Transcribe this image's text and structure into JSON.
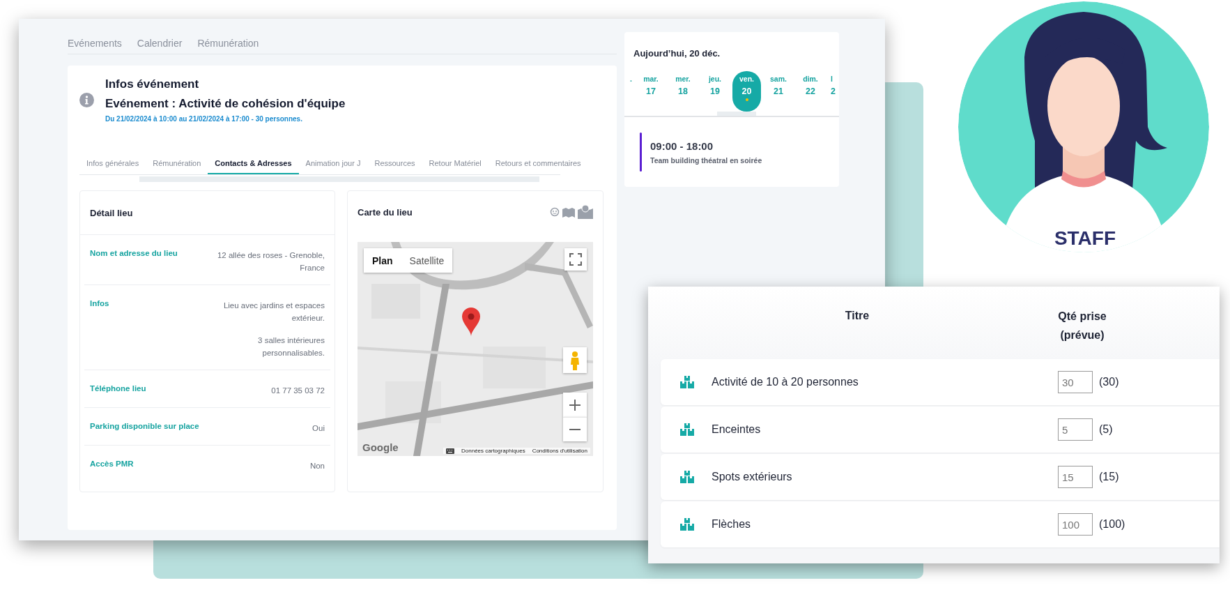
{
  "top_nav": [
    "Evénements",
    "Calendrier",
    "Rémunération"
  ],
  "event": {
    "heading": "Infos événement",
    "title": "Evénement : Activité de cohésion d'équipe",
    "dates": "Du 21/02/2024 à 10:00 au 21/02/2024 à 17:00 - 30 personnes."
  },
  "tabs": [
    {
      "label": "Infos générales",
      "selected": false
    },
    {
      "label": "Rémunération",
      "selected": false
    },
    {
      "label": "Contacts & Adresses",
      "selected": true
    },
    {
      "label": "Animation jour J",
      "selected": false
    },
    {
      "label": "Ressources",
      "selected": false
    },
    {
      "label": "Retour Matériel",
      "selected": false
    },
    {
      "label": "Retours et commentaires",
      "selected": false
    }
  ],
  "detail": {
    "title": "Détail lieu",
    "rows": [
      {
        "label": "Nom et adresse du lieu",
        "values": [
          "12 allée des roses - Grenoble, France"
        ]
      },
      {
        "label": "Infos",
        "values": [
          "Lieu avec jardins et espaces extérieur.",
          "3 salles intérieures personnalisables."
        ]
      },
      {
        "label": "Téléphone lieu",
        "values": [
          "01 77 35 03 72"
        ]
      },
      {
        "label": "Parking disponible sur place",
        "values": [
          "Oui"
        ]
      },
      {
        "label": "Accès PMR",
        "values": [
          "Non"
        ]
      }
    ]
  },
  "map_card": {
    "title": "Carte du lieu",
    "map": {
      "kind": "picture",
      "map_types": [
        {
          "label": "Plan",
          "selected": true
        },
        {
          "label": "Satellite",
          "selected": false
        }
      ],
      "logo": "Google",
      "attribution": [
        "Données cartographiques",
        "Conditions d'utilisation"
      ]
    }
  },
  "calendar": {
    "title": "Aujourd’hui, 20 déc.",
    "days": [
      {
        "weekday": ".",
        "selected": false,
        "has_event": false
      },
      {
        "weekday": "mar.",
        "day": "17",
        "selected": false,
        "has_event": false
      },
      {
        "weekday": "mer.",
        "day": "18",
        "selected": false,
        "has_event": false
      },
      {
        "weekday": "jeu.",
        "day": "19",
        "selected": false,
        "has_event": false
      },
      {
        "weekday": "ven.",
        "day": "20",
        "selected": true,
        "has_event": true
      },
      {
        "weekday": "sam.",
        "day": "21",
        "selected": false,
        "has_event": false
      },
      {
        "weekday": "dim.",
        "day": "22",
        "selected": false,
        "has_event": false
      },
      {
        "weekday": "l",
        "day": "2",
        "selected": false,
        "has_event": false
      }
    ],
    "events": [
      {
        "time": "09:00 - 18:00",
        "title": "Team building théatral en soirée",
        "color": "#5b1fd2"
      }
    ]
  },
  "profile": {
    "label": "STAFF"
  },
  "resources": {
    "columns": [
      "Titre",
      "Qté prise (prévue)"
    ],
    "rows": [
      {
        "title": "Activité de 10 à 20 personnes",
        "quantity": "30",
        "planned": "(30)"
      },
      {
        "title": "Enceintes",
        "quantity": "5",
        "planned": "(5)"
      },
      {
        "title": "Spots extérieurs",
        "quantity": "15",
        "planned": "(15)"
      },
      {
        "title": "Flèches",
        "quantity": "100",
        "planned": "(100)"
      }
    ]
  }
}
